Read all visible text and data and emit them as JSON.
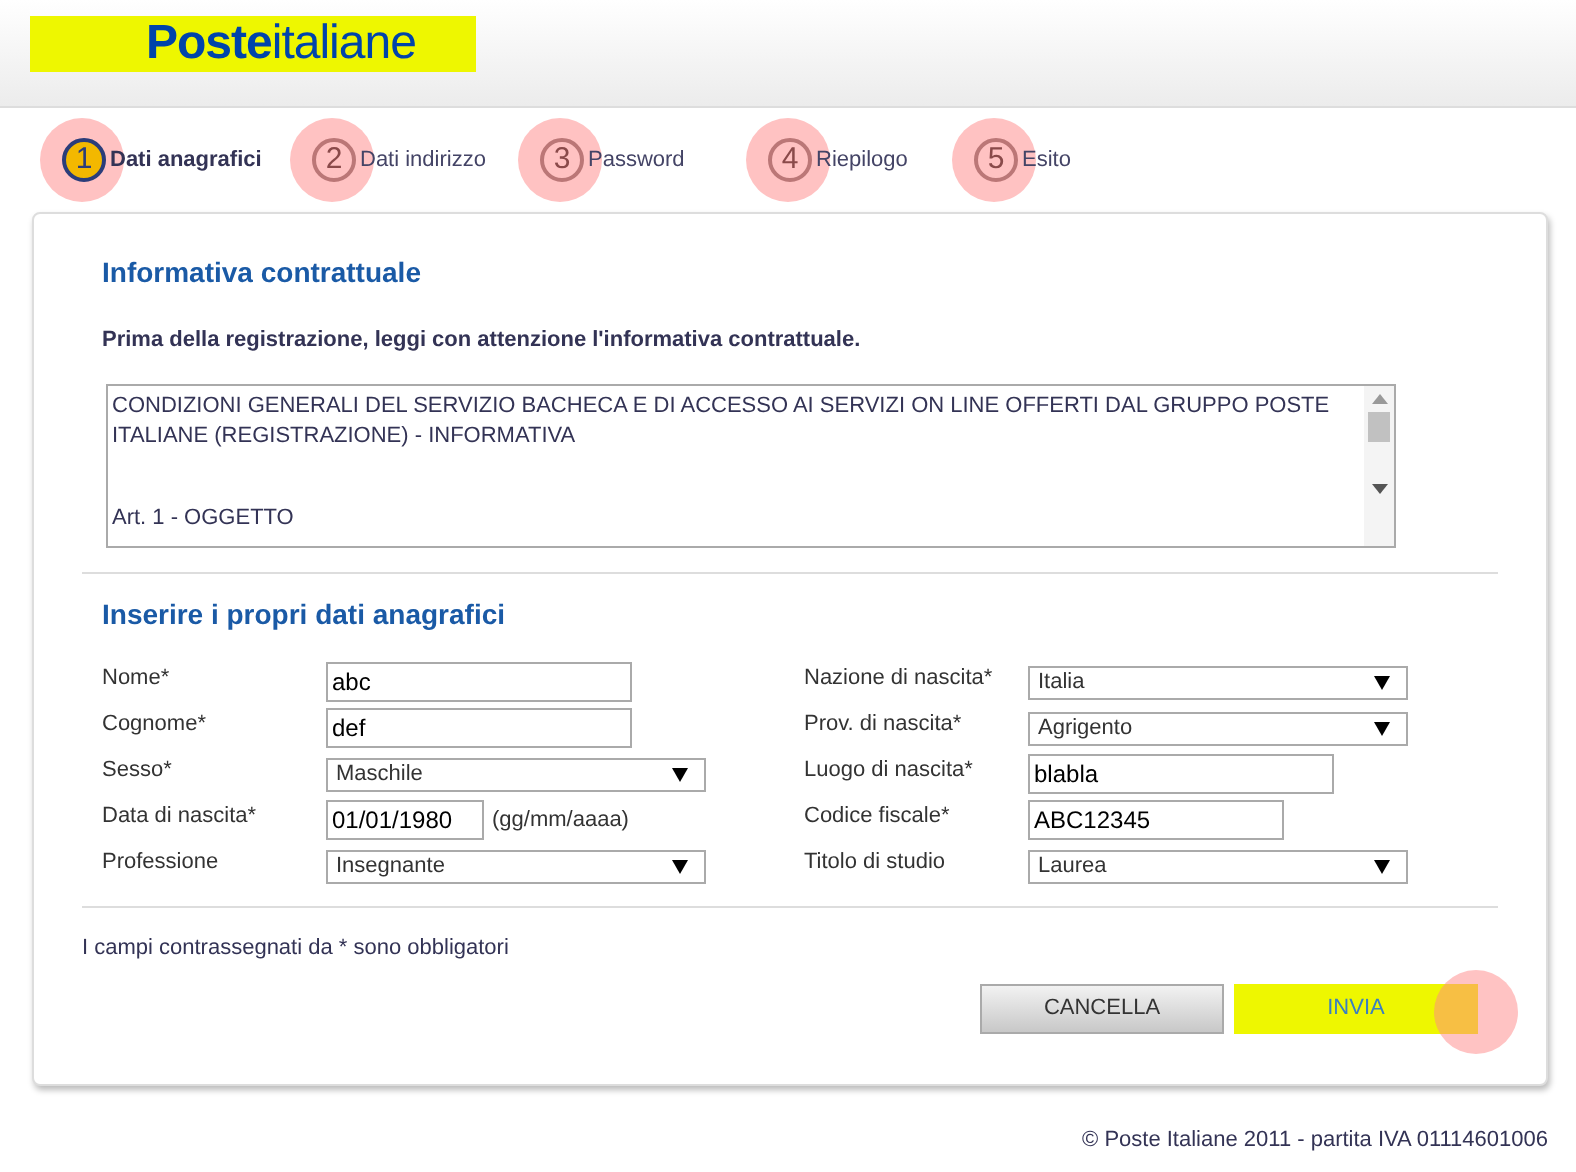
{
  "logo": "**Poste**italiane",
  "steps": [
    {
      "number": "1",
      "label": "Dati anagrafici",
      "selected": true
    },
    {
      "number": "2",
      "label": "Dati indirizzo",
      "selected": false
    },
    {
      "number": "3",
      "label": "Password",
      "selected": false
    },
    {
      "number": "4",
      "label": "Riepilogo",
      "selected": false
    },
    {
      "number": "5",
      "label": "Esito",
      "selected": false
    }
  ],
  "contract": {
    "title": "Informativa contrattuale",
    "intro": "Prima della registrazione, leggi con attenzione l'informativa contrattuale.",
    "lines": [
      "CONDIZIONI GENERALI DEL SERVIZIO BACHECA E DI ACCESSO AI SERVIZI ON LINE OFFERTI DAL GRUPPO POSTE ITALIANE (REGISTRAZIONE) - INFORMATIVA",
      "Art. 1 - OGGETTO"
    ]
  },
  "form": {
    "title": "Inserire i propri dati anagrafici",
    "left": [
      {
        "kind": "text",
        "label": "Nome*",
        "value": "abc"
      },
      {
        "kind": "text",
        "label": "Cognome*",
        "value": "def"
      },
      {
        "kind": "select",
        "label": "Sesso*",
        "value": "Maschile"
      },
      {
        "kind": "date",
        "label": "Data di nascita*",
        "value": "01/01/1980",
        "hint": "(gg/mm/aaaa)"
      },
      {
        "kind": "select",
        "label": "Professione",
        "value": "Insegnante"
      }
    ],
    "right": [
      {
        "kind": "select",
        "label": "Nazione di nascita*",
        "value": "Italia"
      },
      {
        "kind": "select",
        "label": "Prov. di nascita*",
        "value": "Agrigento"
      },
      {
        "kind": "text",
        "label": "Luogo di nascita*",
        "value": "blabla"
      },
      {
        "kind": "short",
        "label": "Codice fiscale*",
        "value": "ABC12345"
      },
      {
        "kind": "select",
        "label": "Titolo di studio",
        "value": "Laurea"
      }
    ]
  },
  "required_note": "I campi contrassegnati da * sono obbligatori",
  "buttons": {
    "cancel": "CANCELLA",
    "send": "INVIA",
    "send_touched": true
  },
  "footer": "© Poste Italiane 2011 - partita IVA 01114601006"
}
